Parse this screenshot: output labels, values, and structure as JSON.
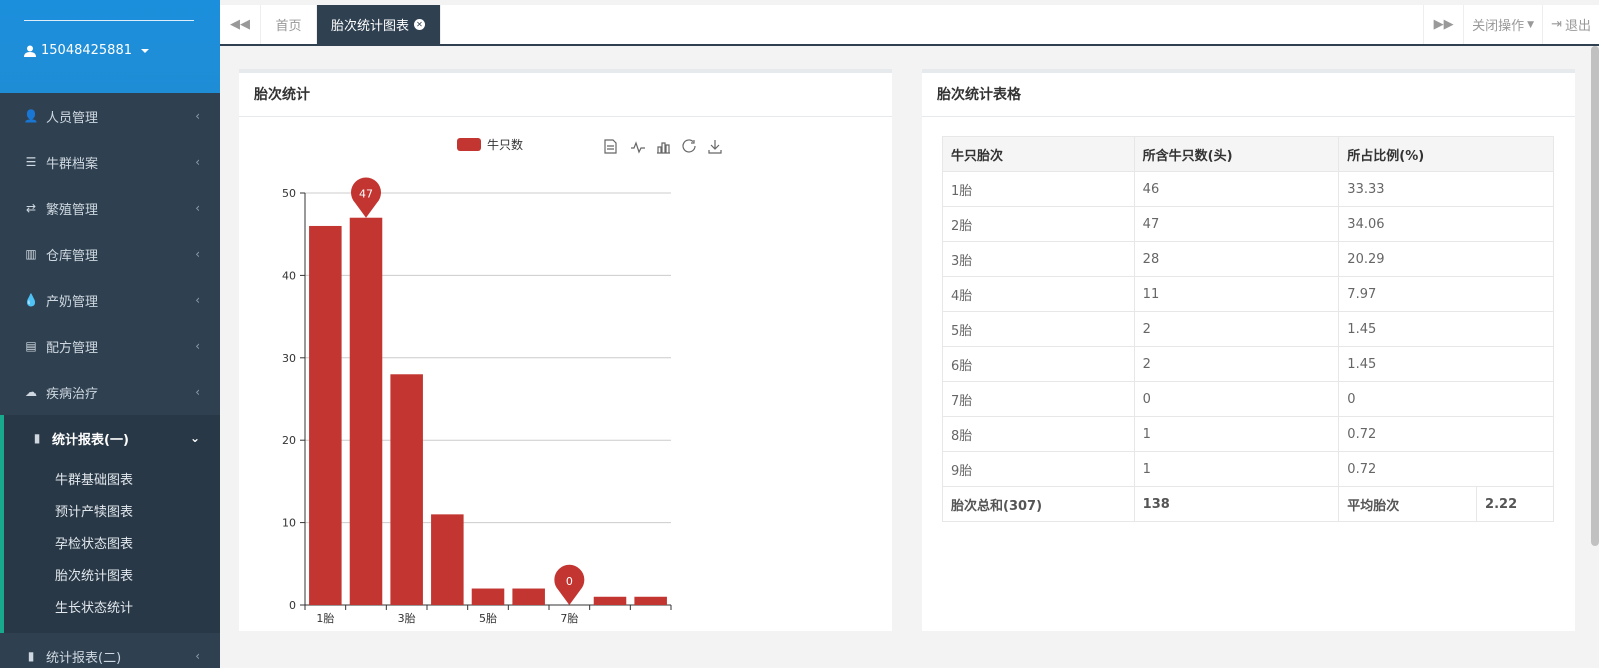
{
  "user": {
    "name": "15048425881"
  },
  "sidebar": {
    "items": [
      {
        "label": "人员管理",
        "icon": "user-icon"
      },
      {
        "label": "牛群档案",
        "icon": "server-icon"
      },
      {
        "label": "繁殖管理",
        "icon": "retweet-icon"
      },
      {
        "label": "仓库管理",
        "icon": "sitemap-icon"
      },
      {
        "label": "产奶管理",
        "icon": "tint-icon"
      },
      {
        "label": "配方管理",
        "icon": "list-alt-icon"
      },
      {
        "label": "疾病治疗",
        "icon": "cloud-icon"
      }
    ],
    "active": {
      "label": "统计报表(一)",
      "icon": "signal-icon"
    },
    "subitems": [
      "牛群基础图表",
      "预计产犊图表",
      "孕检状态图表",
      "胎次统计图表",
      "生长状态统计"
    ],
    "last": {
      "label": "统计报表(二)",
      "icon": "bar-chart-icon"
    }
  },
  "tabs": {
    "home": "首页",
    "active": "胎次统计图表"
  },
  "tools": {
    "close_ops": "关闭操作",
    "logout": "退出"
  },
  "chart_panel": {
    "title": "胎次统计"
  },
  "table_panel": {
    "title": "胎次统计表格"
  },
  "colors": {
    "bar": "#c23531",
    "sidebar": "#2f4050",
    "header": "#1f8dd6",
    "accent": "#19aa8d"
  },
  "chart_data": {
    "type": "bar",
    "categories": [
      "1胎",
      "2胎",
      "3胎",
      "4胎",
      "5胎",
      "6胎",
      "7胎",
      "8胎",
      "9胎"
    ],
    "x_tick_labels": [
      "1胎",
      "3胎",
      "5胎",
      "7胎"
    ],
    "series": [
      {
        "name": "牛只数",
        "values": [
          46,
          47,
          28,
          11,
          2,
          2,
          0,
          1,
          1
        ]
      }
    ],
    "markers": [
      {
        "category": "2胎",
        "value": 47,
        "label": "47"
      },
      {
        "category": "7胎",
        "value": 0,
        "label": "0"
      }
    ],
    "ylim": [
      0,
      50
    ],
    "yticks": [
      0,
      10,
      20,
      30,
      40,
      50
    ],
    "grid": true,
    "legend": "top-center"
  },
  "table": {
    "headers": [
      "牛只胎次",
      "所含牛只数(头)",
      "所占比例(%)"
    ],
    "rows": [
      [
        "1胎",
        "46",
        "33.33"
      ],
      [
        "2胎",
        "47",
        "34.06"
      ],
      [
        "3胎",
        "28",
        "20.29"
      ],
      [
        "4胎",
        "11",
        "7.97"
      ],
      [
        "5胎",
        "2",
        "1.45"
      ],
      [
        "6胎",
        "2",
        "1.45"
      ],
      [
        "7胎",
        "0",
        "0"
      ],
      [
        "8胎",
        "1",
        "0.72"
      ],
      [
        "9胎",
        "1",
        "0.72"
      ]
    ],
    "summary": {
      "label": "胎次总和(307)",
      "count": "138",
      "avg_label": "平均胎次",
      "avg": "2.22"
    }
  }
}
